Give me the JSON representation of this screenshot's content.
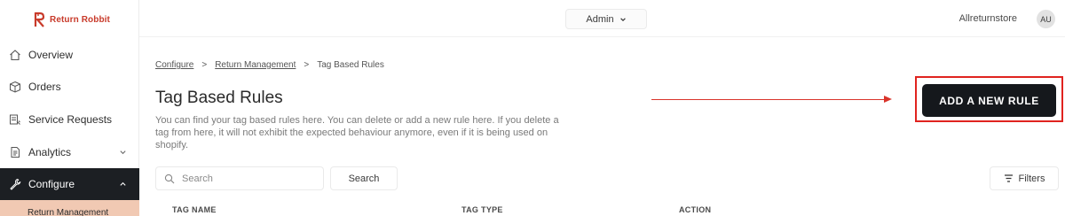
{
  "brand": {
    "name": "Return Robbit",
    "color": "#c83a2a"
  },
  "sidebar": {
    "items": [
      {
        "label": "Overview",
        "icon": "home-icon"
      },
      {
        "label": "Orders",
        "icon": "box-icon"
      },
      {
        "label": "Service Requests",
        "icon": "service-requests-icon"
      },
      {
        "label": "Analytics",
        "icon": "document-icon",
        "expandable": true
      },
      {
        "label": "Configure",
        "icon": "wrench-icon",
        "expandable": true,
        "active": true
      }
    ],
    "sub_item": "Return Management"
  },
  "header": {
    "role": "Admin",
    "store": "Allreturnstore",
    "avatar_initials": "AU"
  },
  "breadcrumb": {
    "items": [
      "Configure",
      "Return Management",
      "Tag Based Rules"
    ],
    "separator": ">"
  },
  "main": {
    "title": "Tag Based Rules",
    "description": "You can find your tag based rules here. You can delete or add a new rule here. If you delete a tag from here, it will not exhibit the expected behaviour anymore, even if it is being used on shopify.",
    "add_button": "ADD A NEW RULE",
    "search": {
      "placeholder": "Search",
      "value": ""
    },
    "search_button": "Search",
    "filters_button": "Filters",
    "table": {
      "columns": [
        "TAG NAME",
        "TAG TYPE",
        "ACTION"
      ]
    }
  },
  "colors": {
    "highlight": "#e0231f",
    "active_nav": "#1c1f23",
    "sub_item_bg": "#f1c9b3"
  }
}
